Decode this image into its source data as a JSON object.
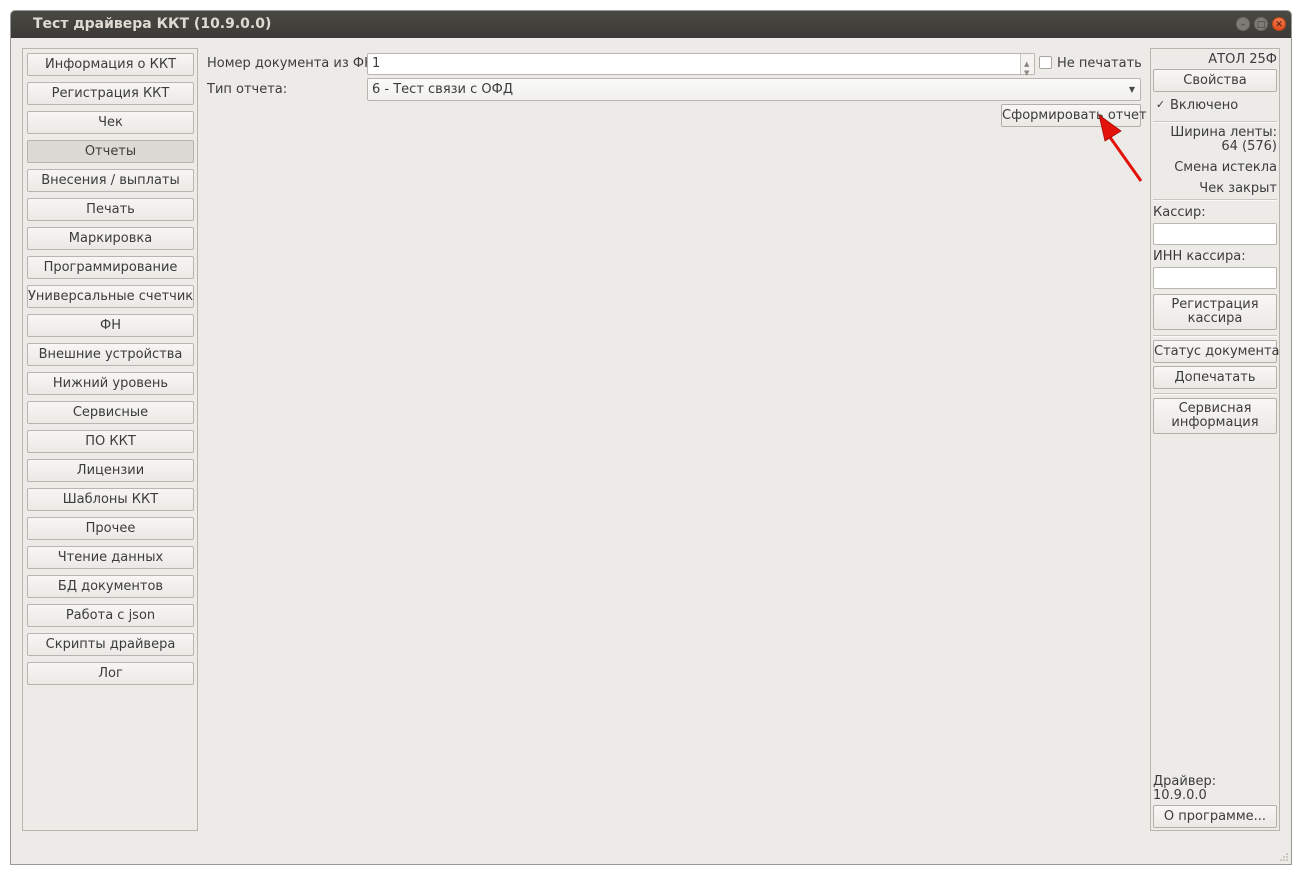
{
  "window": {
    "title": "Тест драйвера ККТ (10.9.0.0)",
    "min_glyph": "–",
    "max_glyph": "□",
    "close_glyph": "✕"
  },
  "sidebar": {
    "items": [
      {
        "label": "Информация о ККТ",
        "active": false
      },
      {
        "label": "Регистрация ККТ",
        "active": false
      },
      {
        "label": "Чек",
        "active": false
      },
      {
        "label": "Отчеты",
        "active": true
      },
      {
        "label": "Внесения / выплаты",
        "active": false
      },
      {
        "label": "Печать",
        "active": false
      },
      {
        "label": "Маркировка",
        "active": false
      },
      {
        "label": "Программирование",
        "active": false
      },
      {
        "label": "Универсальные счетчики",
        "active": false
      },
      {
        "label": "ФН",
        "active": false
      },
      {
        "label": "Внешние устройства",
        "active": false
      },
      {
        "label": "Нижний уровень",
        "active": false
      },
      {
        "label": "Сервисные",
        "active": false
      },
      {
        "label": "ПО ККТ",
        "active": false
      },
      {
        "label": "Лицензии",
        "active": false
      },
      {
        "label": "Шаблоны ККТ",
        "active": false
      },
      {
        "label": "Прочее",
        "active": false
      },
      {
        "label": "Чтение данных",
        "active": false
      },
      {
        "label": "БД документов",
        "active": false
      },
      {
        "label": "Работа с json",
        "active": false
      },
      {
        "label": "Скрипты драйвера",
        "active": false
      },
      {
        "label": "Лог",
        "active": false
      }
    ]
  },
  "main": {
    "doc_number_label": "Номер документа из ФН:",
    "doc_number_value": "1",
    "no_print_label": "Не печатать",
    "no_print_checked": false,
    "report_type_label": "Тип отчета:",
    "report_type_value": "6 - Тест связи с ОФД",
    "generate_button": "Сформировать отчет"
  },
  "right": {
    "model": "АТОЛ 25Ф",
    "properties_button": "Свойства",
    "enabled_label": "Включено",
    "enabled_checked": true,
    "tape_width_label": "Ширина ленты:",
    "tape_width_value": "64 (576)",
    "shift_status": "Смена истекла",
    "receipt_status": "Чек закрыт",
    "cashier_label": "Кассир:",
    "cashier_value": "",
    "cashier_inn_label": "ИНН кассира:",
    "cashier_inn_value": "",
    "register_cashier_line1": "Регистрация",
    "register_cashier_line2": "кассира",
    "doc_status_button": "Статус документа",
    "reprint_button": "Допечатать",
    "service_info_line1": "Сервисная",
    "service_info_line2": "информация",
    "driver_label": "Драйвер:",
    "driver_version": "10.9.0.0",
    "about_button": "О программе..."
  },
  "annotation": {
    "arrow_color": "#e3120b"
  }
}
